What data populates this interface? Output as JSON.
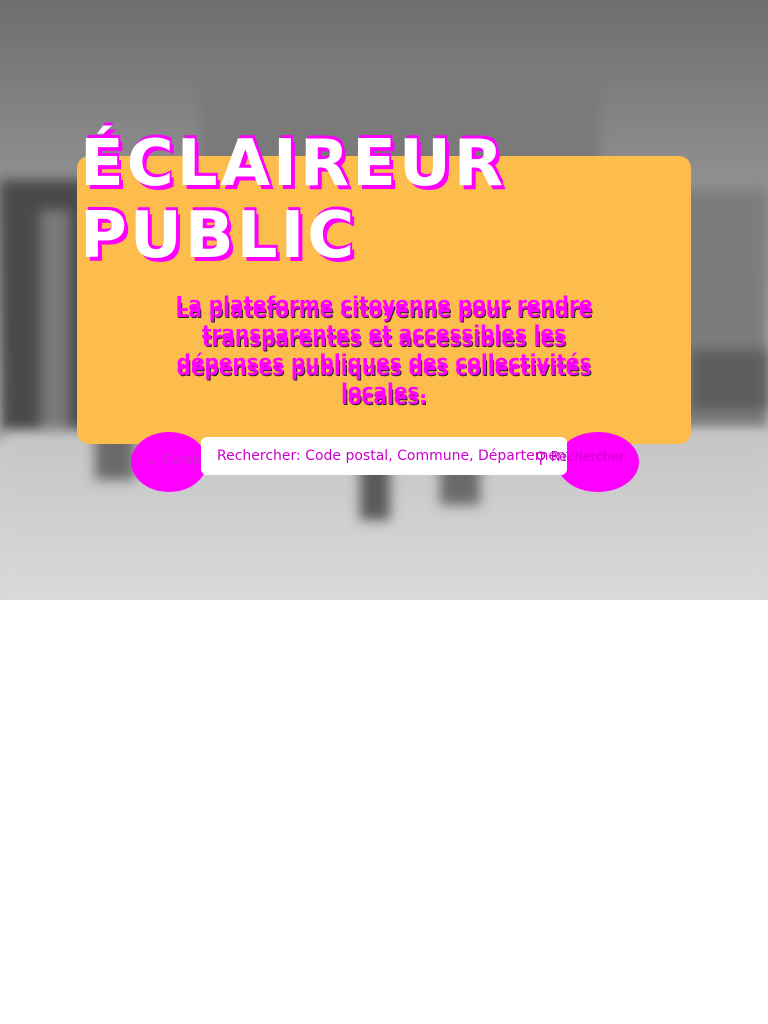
{
  "hero": {
    "title_line1": "ÉCLAIREUR",
    "title_line2": "PUBLIC",
    "subtitle": "La plateforme citoyenne pour rendre transparentes et accessibles les dépenses publiques des collectivités locales."
  },
  "search": {
    "type_select_label": "Commune",
    "placeholder": "Rechercher: Code postal, Commune, Département, Région",
    "button_label": "Rechercher"
  },
  "colors": {
    "accent": "#ff00ff",
    "card": "#fdbd4c"
  },
  "icons": {
    "select": "chevron-down-icon",
    "search": "magnifier-icon"
  }
}
